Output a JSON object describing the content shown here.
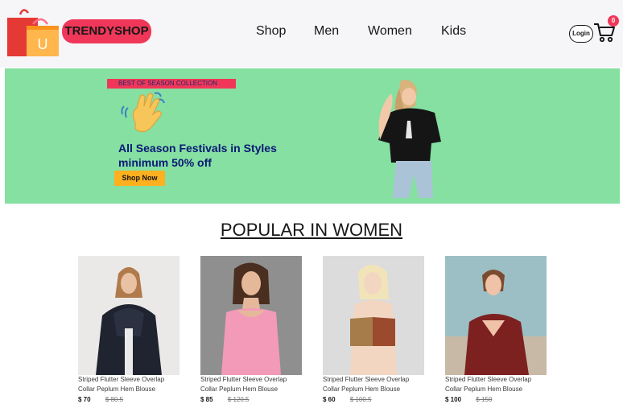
{
  "header": {
    "brand": "TRENDYSHOP",
    "logo_letter": "U",
    "nav": [
      "Shop",
      "Men",
      "Women",
      "Kids"
    ],
    "login_label": "Login",
    "cart_count": "0"
  },
  "hero": {
    "tag": "BEST OF SEASON COLLECTION",
    "title_line1": "All Season Festivals in Styles",
    "title_line2": "minimum 50% off",
    "cta": "Shop Now"
  },
  "section": {
    "title": "POPULAR IN WOMEN"
  },
  "products": [
    {
      "name": "Striped Flutter Sleeve Overlap Collar Peplum Hem Blouse",
      "price": "$ 70",
      "old_price": "$ 80.5"
    },
    {
      "name": "Striped Flutter Sleeve Overlap Collar Peplum Hem Blouse",
      "price": "$ 85",
      "old_price": "$ 120.5"
    },
    {
      "name": "Striped Flutter Sleeve Overlap Collar Peplum Hem Blouse",
      "price": "$ 60",
      "old_price": "$ 100.5"
    },
    {
      "name": "Striped Flutter Sleeve Overlap Collar Peplum Hem Blouse",
      "price": "$ 100",
      "old_price": "$ 150"
    }
  ],
  "colors": {
    "accent": "#f03759",
    "hero_bg": "#85e0a2",
    "cta": "#ffb01f",
    "hero_title": "#0b1876"
  },
  "icons": [
    "shopping-bags-logo",
    "login-pill",
    "cart-icon",
    "waving-hand-icon"
  ]
}
